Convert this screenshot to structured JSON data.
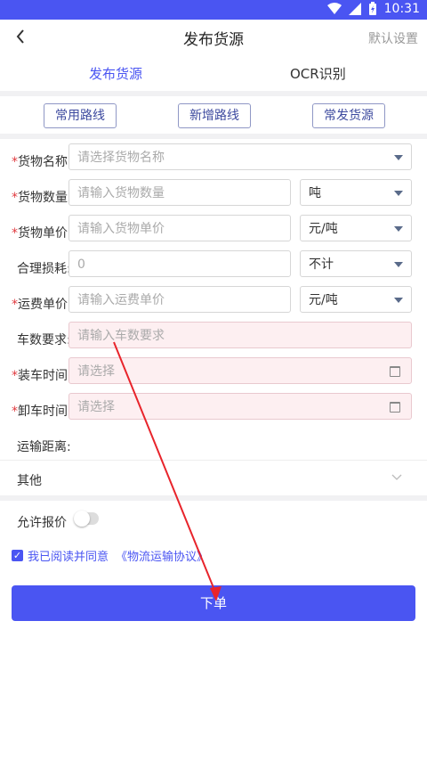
{
  "status_bar": {
    "time": "10:31"
  },
  "navbar": {
    "back_icon": "back-arrow-icon",
    "title": "发布货源",
    "settings": "默认设置"
  },
  "tabs": [
    {
      "label": "发布货源",
      "active": true
    },
    {
      "label": "OCR识别",
      "active": false
    }
  ],
  "quick_buttons": [
    "常用路线",
    "新增路线",
    "常发货源"
  ],
  "form": {
    "cargo_name": {
      "label": "货物名称:",
      "required": true,
      "placeholder": "请选择货物名称"
    },
    "cargo_quantity": {
      "label": "货物数量:",
      "required": true,
      "placeholder": "请输入货物数量",
      "unit": "吨"
    },
    "cargo_price": {
      "label": "货物单价:",
      "required": true,
      "placeholder": "请输入货物单价",
      "unit": "元/吨"
    },
    "loss": {
      "label": "合理损耗:",
      "required": false,
      "value": "0",
      "unit": "不计"
    },
    "freight_price": {
      "label": "运费单价:",
      "required": true,
      "placeholder": "请输入运费单价",
      "unit": "元/吨"
    },
    "vehicle_req": {
      "label": "车数要求:",
      "required": false,
      "placeholder": "请输入车数要求"
    },
    "load_time": {
      "label": "装车时间:",
      "required": true,
      "placeholder": "请选择"
    },
    "unload_time": {
      "label": "卸车时间:",
      "required": true,
      "placeholder": "请选择"
    },
    "distance": {
      "label": "运输距离:"
    },
    "other": {
      "label": "其他"
    },
    "allow_quote": {
      "label": "允许报价",
      "enabled": false
    }
  },
  "agreement": {
    "checked": true,
    "text": "我已阅读并同意",
    "link": "《物流运输协议》"
  },
  "submit_label": "下单",
  "colors": {
    "accent": "#4a55f2",
    "required": "#e0393e",
    "annotation": "#e8242b"
  }
}
